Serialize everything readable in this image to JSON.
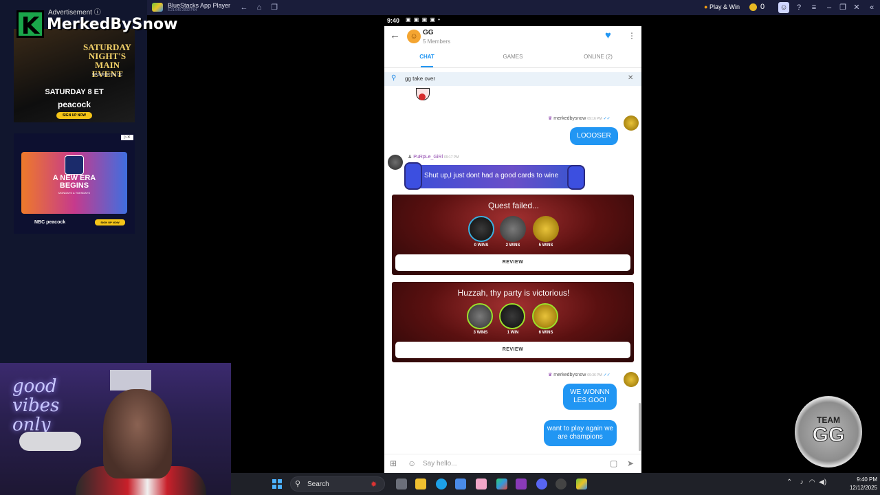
{
  "bluestacks": {
    "title": "BlueStacks App Player",
    "subtitle": "5.21.640.2002 P64",
    "play_win": "Play & Win",
    "coins": "0"
  },
  "overlay": {
    "advertisement": "Advertisement ⓘ",
    "brand_letter": "K",
    "brand_name": "MerkedBySnow",
    "ad1": {
      "main_event": "SATURDAY NIGHT'S MAIN EVENT",
      "location": "WASHINGTON, DC",
      "when": "SATURDAY 8 ET",
      "network": "peacock",
      "cta": "SIGN UP NOW"
    },
    "ad2": {
      "headline": "A NEW ERA BEGINS",
      "nights": "MONDAYS & TUESDAYS",
      "networks": "NBC peacock",
      "cta": "SIGN UP NOW"
    },
    "webcam_neon": "good vibes only",
    "team_badge": {
      "line1": "TEAM",
      "line2": "GG"
    }
  },
  "phone": {
    "status_time": "9:40",
    "status_icons": "▣ ▣ ▣ ▣ •",
    "group": {
      "name": "GG",
      "members": "5 Members",
      "avatar_glyph": "☺"
    },
    "tabs": [
      {
        "label": "CHAT",
        "active": true
      },
      {
        "label": "GAMES",
        "active": false
      },
      {
        "label": "ONLINE (2)",
        "active": false
      }
    ],
    "pinned": "gg take over",
    "messages": [
      {
        "sender": "merkedbysnow",
        "time": "09:16 PM",
        "text": "LOOOSER"
      },
      {
        "sender": "PuRpLe_GiRl",
        "time": "09:17 PM",
        "text": "Shut up,I just dont had a good cards to wine"
      },
      {
        "sender": "merkedbysnow",
        "time": "09:36 PM",
        "texts": [
          "WE WONNN LES GOO!",
          "want to play again we are champions"
        ]
      }
    ],
    "cards": [
      {
        "title": "Quest failed...",
        "players": [
          "0 WINS",
          "2 WINS",
          "5 WINS"
        ],
        "button": "REVIEW"
      },
      {
        "title": "Huzzah, thy party is victorious!",
        "players": [
          "3 WINS",
          "1 WIN",
          "6 WINS"
        ],
        "button": "REVIEW"
      }
    ],
    "input_placeholder": "Say hello..."
  },
  "taskbar": {
    "search": "Search",
    "time": "9:40 PM",
    "date": "12/12/2025"
  },
  "colors": {
    "accent": "#2196f3",
    "win_ring": "#9be12b",
    "card_bg": "#5a1010"
  }
}
